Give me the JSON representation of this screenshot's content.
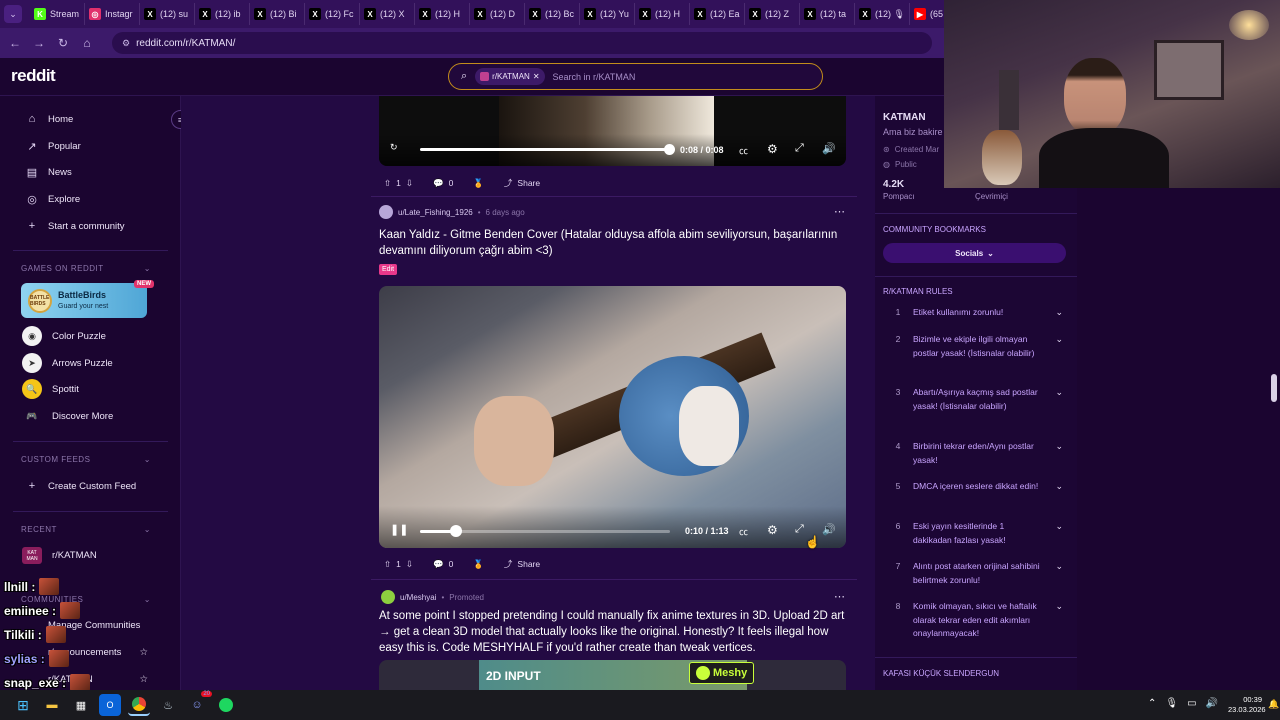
{
  "browser": {
    "tabs": [
      {
        "label": "Stream",
        "icon": "K",
        "color": "#53fc18"
      },
      {
        "label": "Instagr",
        "icon": "◎",
        "color": "#e1306c"
      },
      {
        "label": "(12) su",
        "icon": "X",
        "color": "#000000"
      },
      {
        "label": "(12) ib",
        "icon": "X",
        "color": "#000000"
      },
      {
        "label": "(12) Bi",
        "icon": "X",
        "color": "#000000"
      },
      {
        "label": "(12) Fc",
        "icon": "X",
        "color": "#000000"
      },
      {
        "label": "(12) X",
        "icon": "X",
        "color": "#000000"
      },
      {
        "label": "(12) H",
        "icon": "X",
        "color": "#000000"
      },
      {
        "label": "(12) D",
        "icon": "X",
        "color": "#000000"
      },
      {
        "label": "(12) Bc",
        "icon": "X",
        "color": "#000000"
      },
      {
        "label": "(12) Yu",
        "icon": "X",
        "color": "#000000"
      },
      {
        "label": "(12) H",
        "icon": "X",
        "color": "#000000"
      },
      {
        "label": "(12) Ea",
        "icon": "X",
        "color": "#000000"
      },
      {
        "label": "(12) Z",
        "icon": "X",
        "color": "#000000"
      },
      {
        "label": "(12) ta",
        "icon": "X",
        "color": "#000000"
      },
      {
        "label": "(12) 🎙",
        "icon": "X",
        "color": "#000000"
      },
      {
        "label": "(65",
        "icon": "▶",
        "color": "#ff0000"
      }
    ],
    "url": "reddit.com/r/KATMAN/"
  },
  "header": {
    "logo": "reddit",
    "search_chip": "r/KATMAN",
    "search_placeholder": "Search in r/KATMAN"
  },
  "sidebar": {
    "nav": [
      {
        "label": "Home",
        "icon": "home-icon",
        "glyph": "⌂"
      },
      {
        "label": "Popular",
        "icon": "popular-icon",
        "glyph": "↗"
      },
      {
        "label": "News",
        "icon": "news-icon",
        "glyph": "▤"
      },
      {
        "label": "Explore",
        "icon": "explore-icon",
        "glyph": "◎"
      },
      {
        "label": "Start a community",
        "icon": "plus-icon",
        "glyph": "+"
      }
    ],
    "games_heading": "GAMES ON REDDIT",
    "battlebirds": {
      "title": "BattleBirds",
      "subtitle": "Guard your nest",
      "badge": "NEW",
      "icon_text": "BATTLE BIRDS"
    },
    "games": [
      {
        "label": "Color Puzzle",
        "glyph": "◉",
        "color": "#f2f2f2"
      },
      {
        "label": "Arrows Puzzle",
        "glyph": "➤",
        "color": "#f2f2f2"
      },
      {
        "label": "Spottit",
        "glyph": "🔍",
        "color": "#f5c518"
      },
      {
        "label": "Discover More",
        "glyph": "🎮",
        "color": "transparent"
      }
    ],
    "custom_feeds_heading": "CUSTOM FEEDS",
    "create_feed": "Create Custom Feed",
    "recent_heading": "RECENT",
    "recent_item": "r/KATMAN",
    "recent_icon_text": "KAT MAN",
    "communities_heading": "COMMUNITIES",
    "manage_communities": "Manage Communities",
    "announcements": "r/announcements",
    "katman_sub": "r/KATMAN"
  },
  "post1": {
    "time": "0:08 / 0:08",
    "votes": "1",
    "comments": "0",
    "share": "Share"
  },
  "post2": {
    "author": "u/Late_Fishing_1926",
    "time": "6 days ago",
    "title": "Kaan Yaldız - Gitme Benden Cover (Hatalar olduysa affola abim seviliyorsun, başarılarının devamını diliyorum çağrı abim <3)",
    "flair": "Edit",
    "video_time": "0:10 / 1:13",
    "progress": 0.14,
    "votes": "1",
    "comments": "0",
    "share": "Share"
  },
  "post3": {
    "author": "u/Meshyai",
    "promoted": "Promoted",
    "title": "At some point I stopped pretending I could manually fix anime textures in 3D. Upload 2D art → get a clean 3D model that actually looks like the original. Honestly? It feels illegal how easy this is. Code MESHYHALF if you'd rather create than tweak vertices.",
    "banner_text": "2D INPUT",
    "brand": "Meshy"
  },
  "community": {
    "name": "KATMAN",
    "tagline": "Ama biz bakire",
    "created": "Created Mar",
    "visibility": "Public",
    "members": "4.2K",
    "members_label": "Pompacı",
    "online_label": "Çevrimiçi",
    "bookmarks_heading": "COMMUNITY BOOKMARKS",
    "socials": "Socials",
    "rules_heading": "R/KATMAN RULES",
    "rules": [
      "Etiket kullanımı zorunlu!",
      "Bizimle ve ekiple ilgili olmayan postlar yasak! (İstisnalar olabilir)",
      "Abartı/Aşırıya kaçmış sad postlar yasak! (İstisnalar olabilir)",
      "Birbirini tekrar eden/Aynı postlar yasak!",
      "DMCA içeren seslere dikkat edin!",
      "Eski yayın kesitlerinde 1 dakikadan fazlası yasak!",
      "Alıntı post atarken orijinal sahibini belirtmek zorunlu!",
      "Komik olmayan, sıkıcı ve haftalık olarak tekrar eden edit akımları onaylanmayacak!"
    ],
    "footer_heading": "KAFASI KÜÇÜK SLENDERGUN"
  },
  "chat": [
    {
      "user": "llnill :",
      "color": "#ffffff"
    },
    {
      "user": "emiinee :",
      "color": "#ffffff"
    },
    {
      "user": "Tilkili :",
      "color": "#ffffff"
    },
    {
      "user": "sylias :",
      "color": "#a0a0ff"
    },
    {
      "user": "snap_exe :",
      "color": "#ffffff"
    }
  ],
  "taskbar": {
    "time": "00:39",
    "date": "23.03.2026",
    "discord_badge": "20"
  }
}
